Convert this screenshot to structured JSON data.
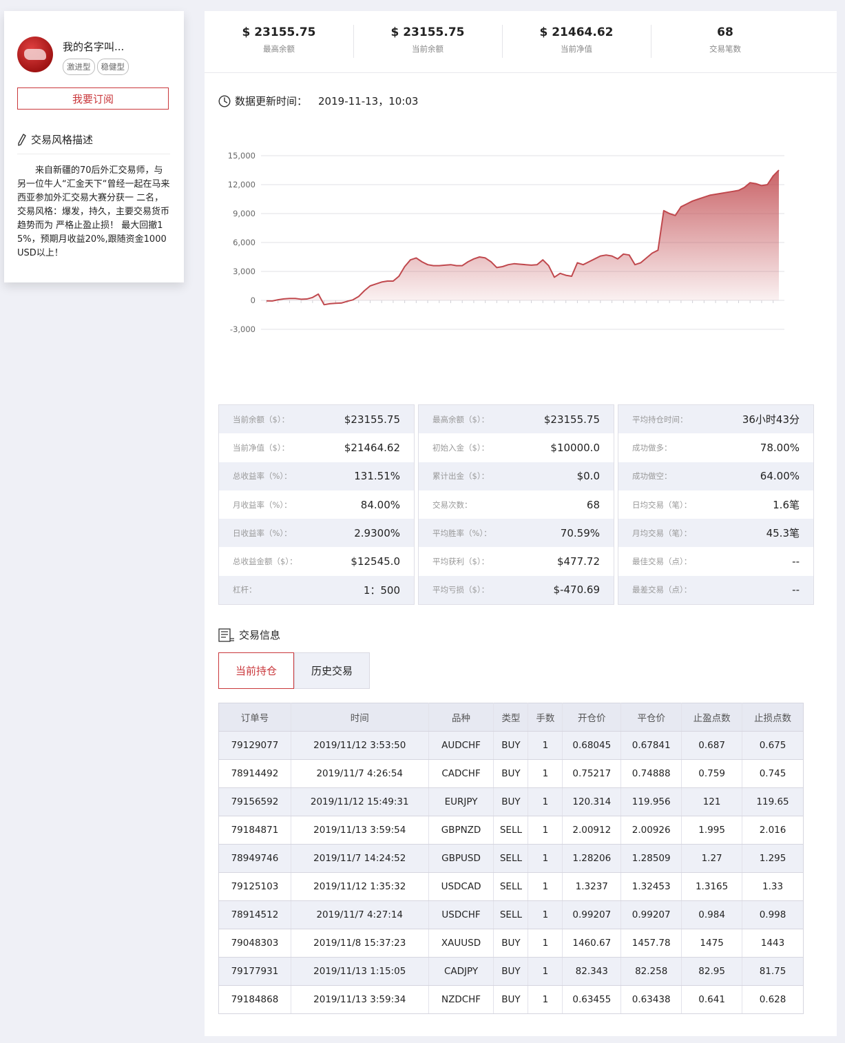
{
  "profile": {
    "name": "我的名字叫...",
    "tags": [
      "激进型",
      "稳健型"
    ],
    "subscribe_label": "我要订阅",
    "style_title": "交易风格描述",
    "style_desc": "来自新疆的70后外汇交易师，与另一位牛人“汇金天下“曾经一起在马来西亚参加外汇交易大赛分获一 二名，交易风格：爆发，持久，主要交易货币 趋势而为  严格止盈止损！  最大回撤15%，预期月收益20%,跟随资金1000USD以上！"
  },
  "summary": [
    {
      "value": "$ 23155.75",
      "label": "最高余额"
    },
    {
      "value": "$ 23155.75",
      "label": "当前余额"
    },
    {
      "value": "$ 21464.62",
      "label": "当前净值"
    },
    {
      "value": "68",
      "label": "交易笔数"
    }
  ],
  "update": {
    "label": "数据更新时间：",
    "value": "2019-11-13，10:03"
  },
  "chart_data": {
    "type": "area",
    "yticks": [
      "15,000",
      "12,000",
      "9,000",
      "6,000",
      "3,000",
      "0",
      "-3,000"
    ],
    "ylim": [
      -3000,
      15000
    ],
    "grid": true,
    "color": "#c0484d",
    "values": [
      -50,
      -60,
      60,
      150,
      200,
      200,
      120,
      140,
      300,
      650,
      -450,
      -350,
      -300,
      -280,
      -100,
      50,
      400,
      1000,
      1500,
      1700,
      1900,
      2000,
      2000,
      2500,
      3500,
      4200,
      4400,
      4000,
      3700,
      3600,
      3600,
      3650,
      3700,
      3600,
      3600,
      4000,
      4300,
      4500,
      4400,
      4000,
      3400,
      3500,
      3700,
      3800,
      3750,
      3700,
      3650,
      3700,
      4200,
      3600,
      2400,
      2800,
      2600,
      2500,
      3900,
      3700,
      4000,
      4300,
      4600,
      4700,
      4600,
      4300,
      4800,
      4700,
      3700,
      3900,
      4400,
      4900,
      5200,
      9300,
      9000,
      8800,
      9700,
      10000,
      10300,
      10500,
      10700,
      10900,
      11000,
      11100,
      11200,
      11300,
      11400,
      11700,
      12200,
      12100,
      11900,
      12000,
      12900,
      13500
    ]
  },
  "stats": [
    [
      {
        "label": "当前余额（$）：",
        "value": "$23155.75"
      },
      {
        "label": "当前净值（$）：",
        "value": "$21464.62"
      },
      {
        "label": "总收益率（%）：",
        "value": "131.51%"
      },
      {
        "label": "月收益率（%）：",
        "value": "84.00%"
      },
      {
        "label": "日收益率（%）：",
        "value": "2.9300%"
      },
      {
        "label": "总收益金额（$）：",
        "value": "$12545.0"
      },
      {
        "label": "杠杆：",
        "value": "1：500"
      }
    ],
    [
      {
        "label": "最高余额（$）：",
        "value": "$23155.75"
      },
      {
        "label": "初始入金（$）：",
        "value": "$10000.0"
      },
      {
        "label": "累计出金（$）：",
        "value": "$0.0"
      },
      {
        "label": "交易次数：",
        "value": "68"
      },
      {
        "label": "平均胜率（%）：",
        "value": "70.59%"
      },
      {
        "label": "平均获利（$）：",
        "value": "$477.72"
      },
      {
        "label": "平均亏损（$）：",
        "value": "$-470.69"
      }
    ],
    [
      {
        "label": "平均持仓时间：",
        "value": "36小时43分"
      },
      {
        "label": "成功做多：",
        "value": "78.00%"
      },
      {
        "label": "成功做空：",
        "value": "64.00%"
      },
      {
        "label": "日均交易（笔）：",
        "value": "1.6笔"
      },
      {
        "label": "月均交易（笔）：",
        "value": "45.3笔"
      },
      {
        "label": "最佳交易（点）：",
        "value": "--"
      },
      {
        "label": "最差交易（点）：",
        "value": "--"
      }
    ]
  ],
  "trade": {
    "title": "交易信息",
    "tabs": [
      {
        "label": "当前持仓",
        "active": true
      },
      {
        "label": "历史交易",
        "active": false
      }
    ],
    "columns": [
      "订单号",
      "时间",
      "品种",
      "类型",
      "手数",
      "开仓价",
      "平仓价",
      "止盈点数",
      "止损点数"
    ],
    "rows": [
      [
        "79129077",
        "2019/11/12 3:53:50",
        "AUDCHF",
        "BUY",
        "1",
        "0.68045",
        "0.67841",
        "0.687",
        "0.675"
      ],
      [
        "78914492",
        "2019/11/7 4:26:54",
        "CADCHF",
        "BUY",
        "1",
        "0.75217",
        "0.74888",
        "0.759",
        "0.745"
      ],
      [
        "79156592",
        "2019/11/12 15:49:31",
        "EURJPY",
        "BUY",
        "1",
        "120.314",
        "119.956",
        "121",
        "119.65"
      ],
      [
        "79184871",
        "2019/11/13 3:59:54",
        "GBPNZD",
        "SELL",
        "1",
        "2.00912",
        "2.00926",
        "1.995",
        "2.016"
      ],
      [
        "78949746",
        "2019/11/7 14:24:52",
        "GBPUSD",
        "SELL",
        "1",
        "1.28206",
        "1.28509",
        "1.27",
        "1.295"
      ],
      [
        "79125103",
        "2019/11/12 1:35:32",
        "USDCAD",
        "SELL",
        "1",
        "1.3237",
        "1.32453",
        "1.3165",
        "1.33"
      ],
      [
        "78914512",
        "2019/11/7 4:27:14",
        "USDCHF",
        "SELL",
        "1",
        "0.99207",
        "0.99207",
        "0.984",
        "0.998"
      ],
      [
        "79048303",
        "2019/11/8 15:37:23",
        "XAUUSD",
        "BUY",
        "1",
        "1460.67",
        "1457.78",
        "1475",
        "1443"
      ],
      [
        "79177931",
        "2019/11/13 1:15:05",
        "CADJPY",
        "BUY",
        "1",
        "82.343",
        "82.258",
        "82.95",
        "81.75"
      ],
      [
        "79184868",
        "2019/11/13 3:59:34",
        "NZDCHF",
        "BUY",
        "1",
        "0.63455",
        "0.63438",
        "0.641",
        "0.628"
      ]
    ]
  },
  "icons": {
    "clock": "clock-icon",
    "pencil": "pencil-icon",
    "document": "document-list-icon"
  },
  "colors": {
    "accent": "#c9363a",
    "stripe": "#eef0f7",
    "background": "#eff0f6"
  }
}
